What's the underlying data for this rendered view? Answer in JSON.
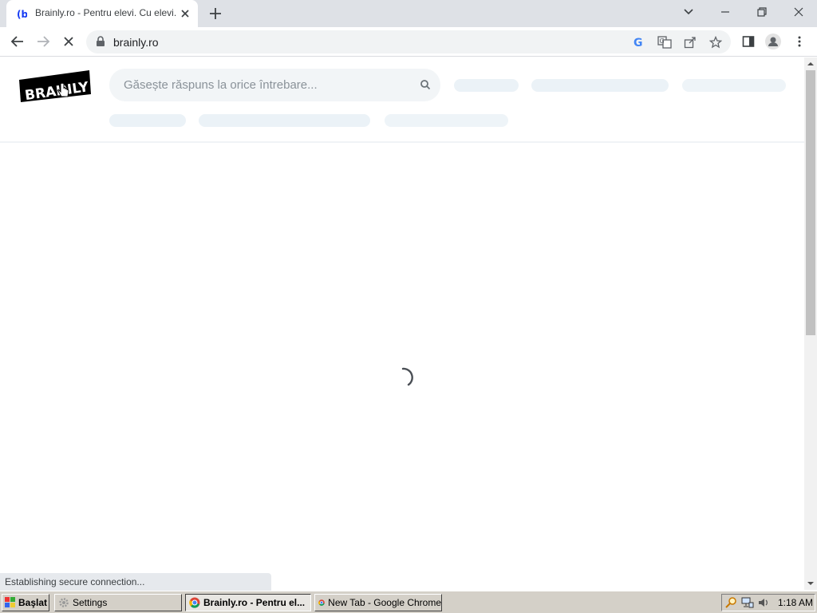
{
  "browser": {
    "tab_title": "Brainly.ro - Pentru elevi. Cu elevi.",
    "url": "brainly.ro",
    "status_text": "Establishing secure connection..."
  },
  "site": {
    "logo_text": "BRAINLY",
    "search_placeholder": "Găsește răspuns la orice întrebare..."
  },
  "taskbar": {
    "start_label": "Başlat",
    "tasks": [
      {
        "label": "Settings"
      },
      {
        "label": "Brainly.ro - Pentru el..."
      },
      {
        "label": "New Tab - Google Chrome"
      }
    ],
    "clock": "1:18 AM"
  },
  "colors": {
    "brand": "#000000",
    "skeleton": "#ebf2f7",
    "chrome_frame": "#dee1e6"
  }
}
